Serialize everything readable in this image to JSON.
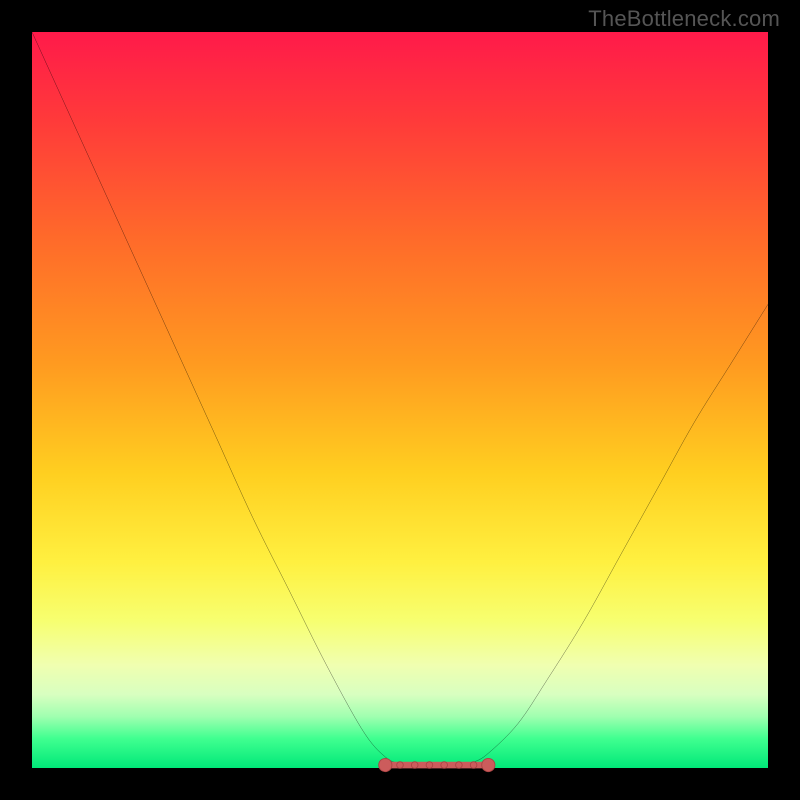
{
  "watermark": {
    "text": "TheBottleneck.com"
  },
  "colors": {
    "frame": "#000000",
    "curve": "#000000",
    "marker_fill": "#cc5c5c",
    "marker_stroke": "#aa4444"
  },
  "gradient_stops": [
    {
      "pct": 0,
      "color": "#ff1a4a"
    },
    {
      "pct": 12,
      "color": "#ff3a3a"
    },
    {
      "pct": 28,
      "color": "#ff6a2a"
    },
    {
      "pct": 45,
      "color": "#ff9a20"
    },
    {
      "pct": 60,
      "color": "#ffcf20"
    },
    {
      "pct": 72,
      "color": "#fff040"
    },
    {
      "pct": 80,
      "color": "#f7ff70"
    },
    {
      "pct": 86,
      "color": "#f0ffb0"
    },
    {
      "pct": 90,
      "color": "#d8ffc0"
    },
    {
      "pct": 93,
      "color": "#a0ffb0"
    },
    {
      "pct": 96,
      "color": "#40ff90"
    },
    {
      "pct": 100,
      "color": "#00e878"
    }
  ],
  "chart_data": {
    "type": "line",
    "title": "",
    "xlabel": "",
    "ylabel": "",
    "xlim": [
      0,
      100
    ],
    "ylim": [
      0,
      100
    ],
    "grid": false,
    "legend": false,
    "series": [
      {
        "name": "bottleneck-curve",
        "x": [
          0,
          5,
          10,
          15,
          20,
          25,
          30,
          35,
          40,
          45,
          48,
          50,
          52,
          54,
          56,
          58,
          60,
          62,
          66,
          70,
          75,
          80,
          85,
          90,
          95,
          100
        ],
        "y": [
          100,
          89,
          78,
          67,
          56,
          45,
          34,
          24,
          14,
          5,
          1.5,
          0.6,
          0.3,
          0.2,
          0.2,
          0.3,
          0.8,
          2,
          6,
          12,
          20,
          29,
          38,
          47,
          55,
          63
        ]
      }
    ],
    "flat_segment": {
      "x_start": 48,
      "x_end": 62,
      "y": 0.4,
      "end_markers_r": 0.9,
      "mid_dots_x": [
        50,
        52,
        54,
        56,
        58,
        60
      ]
    }
  }
}
